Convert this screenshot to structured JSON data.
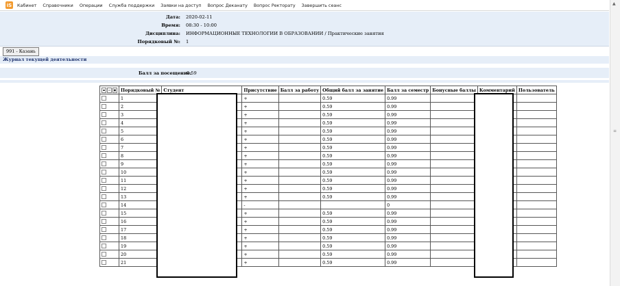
{
  "menubar": {
    "logo": "iS",
    "items": [
      "Кабинет",
      "Справочники",
      "Операции",
      "Служба поддержки",
      "Заявки на доступ",
      "Вопрос Деканату",
      "Вопрос Ректорату",
      "Завершить сеанс"
    ]
  },
  "info": {
    "date_label": "Дата:",
    "date_value": "2020-02-11",
    "time_label": "Время:",
    "time_value": "08:30 - 10:00",
    "discipline_label": "Дисциплина:",
    "discipline_value": "ИНФОРМАЦИОННЫЕ ТЕХНОЛОГИИ В ОБРАЗОВАНИИ / Практические занятия",
    "order_label": "Порядковый №:",
    "order_value": "1"
  },
  "group_button": "991 - Казань",
  "journal_title": "Журнал текущей деятельности",
  "attendance": {
    "label": "Балл за посещение:",
    "value": "0.59"
  },
  "table": {
    "columns": [
      "Порядковый №",
      "Студент",
      "Присутствие",
      "Балл за работу",
      "Общий балл за занятие",
      "Балл за семестр",
      "Бонусные баллы",
      "Комментарий",
      "Пользователь"
    ],
    "rows": [
      {
        "n": "1",
        "presence": "+",
        "total": "0.59",
        "semester": "0.99"
      },
      {
        "n": "2",
        "presence": "+",
        "total": "0.59",
        "semester": "0.99"
      },
      {
        "n": "3",
        "presence": "+",
        "total": "0.59",
        "semester": "0.99"
      },
      {
        "n": "4",
        "presence": "+",
        "total": "0.59",
        "semester": "0.99"
      },
      {
        "n": "5",
        "presence": "+",
        "total": "0.59",
        "semester": "0.99"
      },
      {
        "n": "6",
        "presence": "+",
        "total": "0.59",
        "semester": "0.99"
      },
      {
        "n": "7",
        "presence": "+",
        "total": "0.59",
        "semester": "0.99"
      },
      {
        "n": "8",
        "presence": "+",
        "total": "0.59",
        "semester": "0.99"
      },
      {
        "n": "9",
        "presence": "+",
        "total": "0.59",
        "semester": "0.99"
      },
      {
        "n": "10",
        "presence": "+",
        "total": "0.59",
        "semester": "0.99"
      },
      {
        "n": "11",
        "presence": "+",
        "total": "0.59",
        "semester": "0.99"
      },
      {
        "n": "12",
        "presence": "+",
        "total": "0.59",
        "semester": "0.99"
      },
      {
        "n": "13",
        "presence": "+",
        "total": "0.59",
        "semester": "0.99"
      },
      {
        "n": "14",
        "presence": "-",
        "total": "",
        "semester": "0"
      },
      {
        "n": "15",
        "presence": "+",
        "total": "0.59",
        "semester": "0.99"
      },
      {
        "n": "16",
        "presence": "+",
        "total": "0.59",
        "semester": "0.99"
      },
      {
        "n": "17",
        "presence": "+",
        "total": "0.59",
        "semester": "0.99"
      },
      {
        "n": "18",
        "presence": "+",
        "total": "0.59",
        "semester": "0.99"
      },
      {
        "n": "19",
        "presence": "+",
        "total": "0.59",
        "semester": "0.99"
      },
      {
        "n": "20",
        "presence": "+",
        "total": "0.59",
        "semester": "0.99"
      },
      {
        "n": "21",
        "presence": "+",
        "total": "0.59",
        "semester": "0.99"
      }
    ]
  }
}
